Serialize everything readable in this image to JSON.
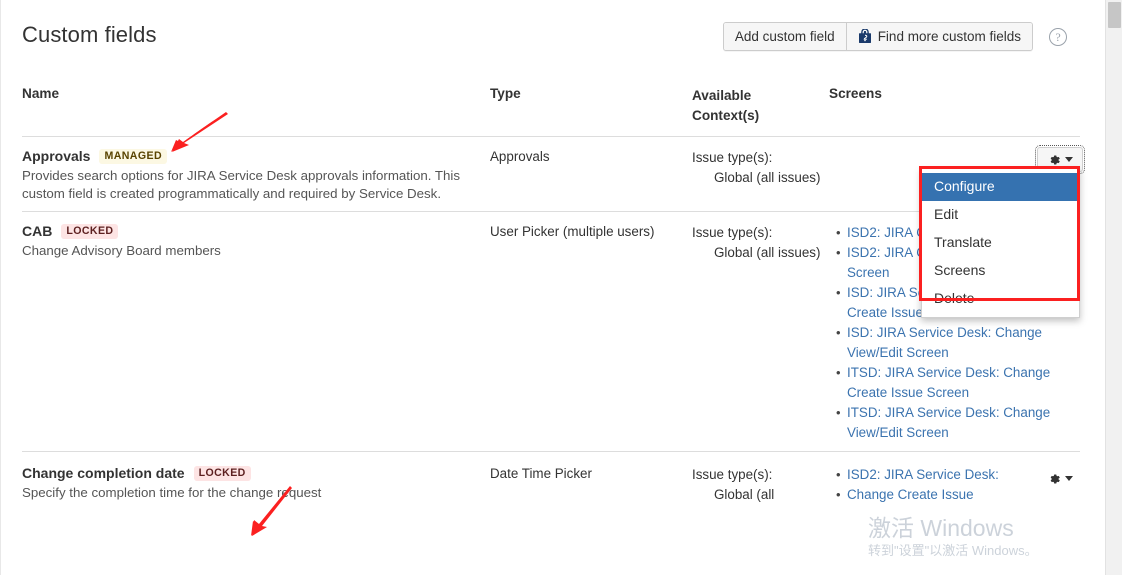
{
  "header": {
    "title": "Custom fields",
    "add_button": "Add custom field",
    "find_button": "Find more custom fields",
    "find_icon": "marketplace-bag-icon",
    "help_icon": "question-mark-icon",
    "help_glyph": "?"
  },
  "table": {
    "columns": {
      "name": "Name",
      "type": "Type",
      "context_line1": "Available",
      "context_line2": "Context(s)",
      "screens": "Screens"
    },
    "rows": [
      {
        "name": "Approvals",
        "badge": "MANAGED",
        "badge_kind": "managed",
        "description": "Provides search options for JIRA Service Desk approvals information. This custom field is created programmatically and required by Service Desk.",
        "type": "Approvals",
        "context_label": "Issue type(s):",
        "context_value": "Global (all issues)",
        "screens": []
      },
      {
        "name": "CAB",
        "badge": "LOCKED",
        "badge_kind": "locked",
        "description": "Change Advisory Board members",
        "type": "User Picker (multiple users)",
        "context_label": "Issue type(s):",
        "context_value": "Global (all issues)",
        "screens": [
          "ISD2: JIRA Change Cr Screen",
          "ISD2: JIRA Change View/Edit Screen",
          "ISD: JIRA Service Desk: Change Create Issue Screen",
          "ISD: JIRA Service Desk: Change View/Edit Screen",
          "ITSD: JIRA Service Desk: Change Create Issue Screen",
          "ITSD: JIRA Service Desk: Change View/Edit Screen"
        ]
      },
      {
        "name": "Change completion date",
        "badge": "LOCKED",
        "badge_kind": "locked",
        "description": "Specify the completion time for the change request",
        "type": "Date Time Picker",
        "context_label": "Issue type(s):",
        "context_value": "Global (all",
        "screens": [
          "ISD2: JIRA Service Desk:",
          "Change Create Issue"
        ]
      }
    ]
  },
  "cog_menu": {
    "trigger_icon": "gear-icon",
    "caret_icon": "chevron-down-icon",
    "items": [
      {
        "label": "Configure",
        "selected": true
      },
      {
        "label": "Edit",
        "selected": false
      },
      {
        "label": "Translate",
        "selected": false
      },
      {
        "label": "Screens",
        "selected": false
      },
      {
        "label": "Delete",
        "selected": false
      }
    ]
  },
  "annotations": {
    "arrow_color": "#fb2020",
    "box_color": "#fb2020",
    "arrow_top_icon": "red-arrow-icon",
    "arrow_bottom_icon": "red-arrow-icon"
  },
  "watermark": {
    "line1": "激活 Windows",
    "line2": "转到\"设置\"以激活 Windows。"
  },
  "scrollbar": {
    "thumb_icon": "scrollbar-thumb"
  }
}
